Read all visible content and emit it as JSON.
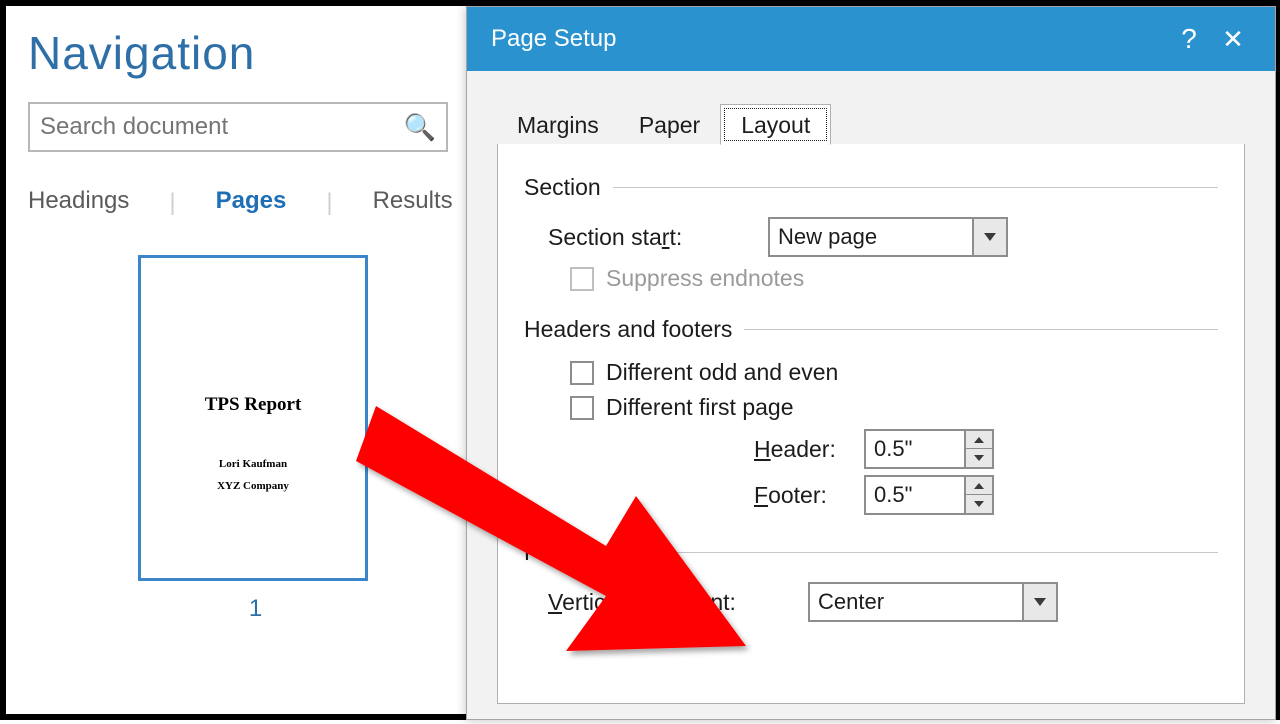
{
  "navigation": {
    "title": "Navigation",
    "search_placeholder": "Search document",
    "tabs": [
      "Headings",
      "Pages",
      "Results"
    ],
    "active_tab": "Pages",
    "thumbnail": {
      "doc_title": "TPS Report",
      "line1": "Lori Kaufman",
      "line2": "XYZ Company",
      "page_number": "1"
    }
  },
  "dialog": {
    "title": "Page Setup",
    "tabs": {
      "margins": "Margins",
      "paper": "Paper",
      "layout": "Layout"
    },
    "active_tab": "Layout",
    "section": {
      "heading": "Section",
      "start_label_pre": "Section sta",
      "start_label_u": "r",
      "start_label_post": "t:",
      "start_value": "New page",
      "suppress_pre": "S",
      "suppress_u": "u",
      "suppress_post": "ppress endnotes"
    },
    "headers_footers": {
      "heading": "Headers and footers",
      "odd_even_pre": "Different ",
      "odd_even_u": "o",
      "odd_even_post": "dd and even",
      "first_page_pre": "Different first ",
      "first_page_u": "p",
      "first_page_post": "age",
      "header_u": "H",
      "header_post": "eader:",
      "header_value": "0.5\"",
      "footer_u": "F",
      "footer_post": "ooter:",
      "footer_value": "0.5\""
    },
    "page": {
      "heading": "Page",
      "valign_u": "V",
      "valign_post": "ertical alignment:",
      "valign_value": "Center"
    }
  }
}
